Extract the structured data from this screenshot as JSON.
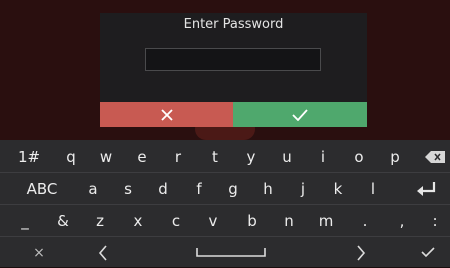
{
  "dialog": {
    "title": "Enter Password",
    "password_value": ""
  },
  "actions": {
    "cancel_icon": "close-icon",
    "confirm_icon": "check-icon"
  },
  "keyboard": {
    "row1": [
      "1#",
      "q",
      "w",
      "e",
      "r",
      "t",
      "y",
      "u",
      "i",
      "o",
      "p"
    ],
    "row2": [
      "ABC",
      "a",
      "s",
      "d",
      "f",
      "g",
      "h",
      "j",
      "k",
      "l"
    ],
    "row3": [
      "_",
      "&",
      "z",
      "x",
      "c",
      "v",
      "b",
      "n",
      "m",
      ".",
      ",",
      ":"
    ],
    "row4": {
      "close": "×"
    }
  },
  "colors": {
    "cancel": "#c85a52",
    "confirm": "#4fa86d",
    "keyboard_bg": "#2c2c2e"
  }
}
